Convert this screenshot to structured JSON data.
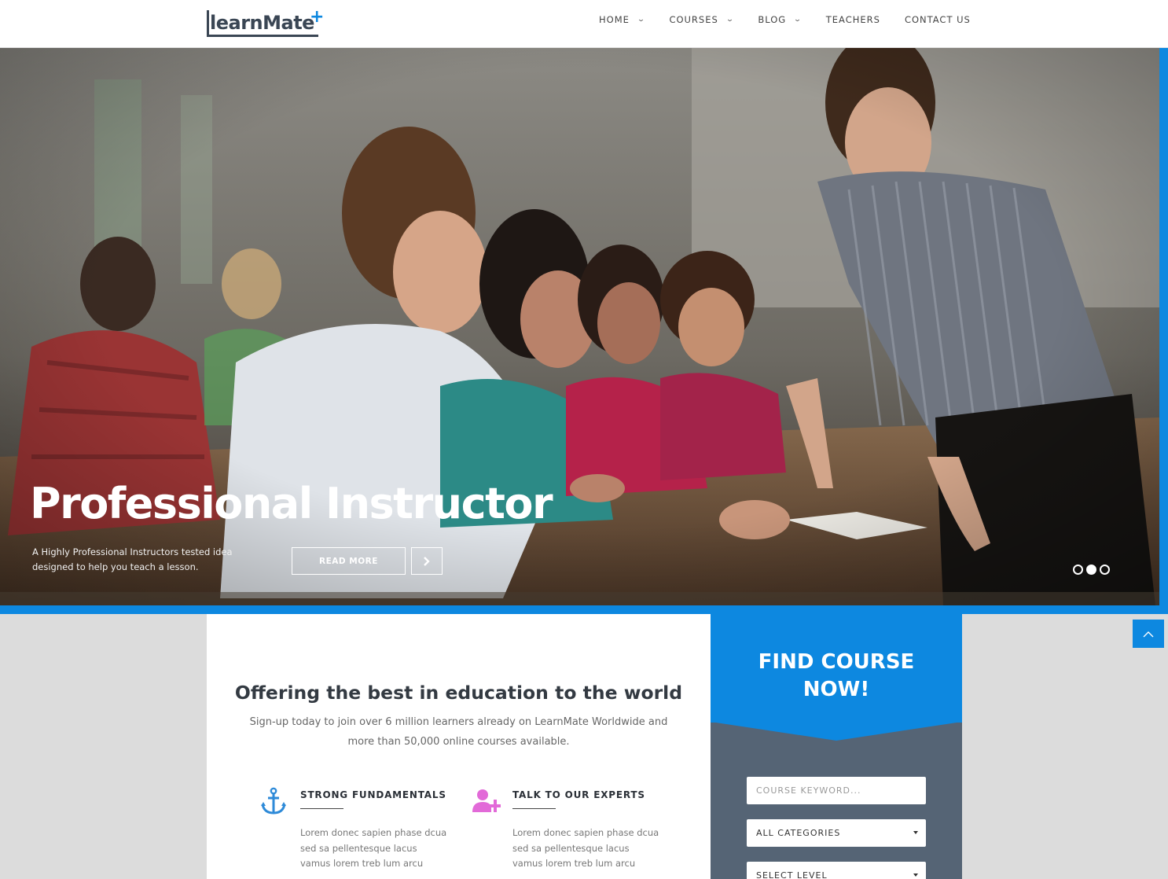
{
  "header": {
    "logo_text": "learnMate",
    "logo_plus": "+",
    "nav": [
      {
        "label": "HOME",
        "dropdown": true
      },
      {
        "label": "COURSES",
        "dropdown": true
      },
      {
        "label": "BLOG",
        "dropdown": true
      },
      {
        "label": "TEACHERS",
        "dropdown": false
      },
      {
        "label": "CONTACT US",
        "dropdown": false
      }
    ],
    "chevron_icon": "chevron-down-icon"
  },
  "hero": {
    "title": "Professional Instructor",
    "description": "A Highly Professional Instructors tested idea designed to help you teach a lesson.",
    "read_more": "READ MORE",
    "next_icon": "chevron-right-icon",
    "slides_count": 3,
    "active_slide": 2
  },
  "intro": {
    "title": "Offering the best in education to the world",
    "subtitle": "Sign-up today to join over 6 million learners already on LearnMate Worldwide and more than 50,000 online courses available."
  },
  "features": [
    {
      "icon": "anchor-icon",
      "title": "STRONG FUNDAMENTALS",
      "text": "Lorem donec sapien phase dcua sed sa pellentesque lacus vamus lorem treb lum arcu"
    },
    {
      "icon": "add-user-icon",
      "title": "TALK TO OUR EXPERTS",
      "text": "Lorem donec sapien phase dcua sed sa pellentesque lacus vamus lorem treb lum arcu"
    }
  ],
  "find_course": {
    "title": "FIND COURSE NOW!",
    "keyword_placeholder": "COURSE KEYWORD...",
    "category_selected": "ALL CATEGORIES",
    "level_selected": "SELECT LEVEL"
  },
  "colors": {
    "accent": "#0d88e0",
    "panel": "#556475",
    "feature_icon_blue": "#2e8ad8",
    "feature_icon_pink": "#e26ad8"
  }
}
